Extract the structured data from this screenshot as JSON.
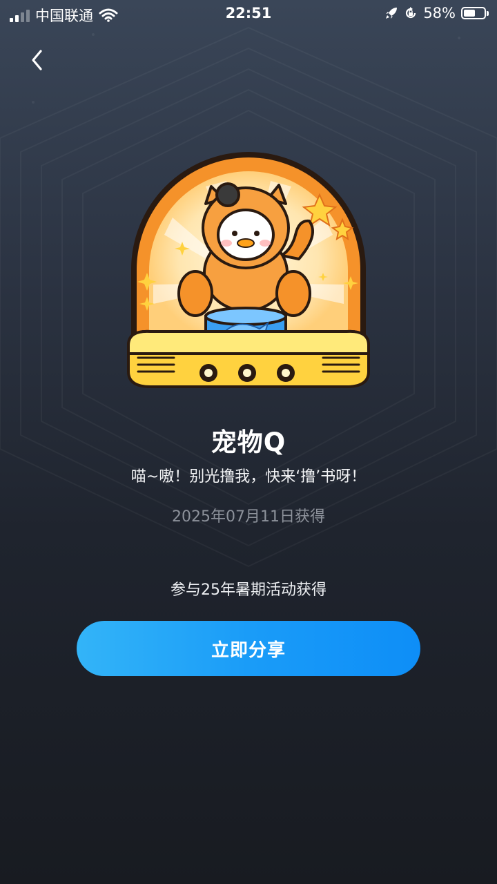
{
  "status_bar": {
    "carrier": "中国联通",
    "time": "22:51",
    "battery_percent": "58%",
    "battery_level": 0.58,
    "icons": [
      "signal-icon",
      "wifi-icon",
      "rocket-icon",
      "rotation-lock-icon",
      "battery-icon"
    ]
  },
  "nav": {
    "back_icon": "chevron-left-icon"
  },
  "badge": {
    "name": "宠物Q",
    "slogan": "喵~嗷！别光撸我，快来‘撸’书呀！",
    "obtained_date": "2025年07月11日获得",
    "description": "参与25年暑期活动获得"
  },
  "actions": {
    "share_label": "立即分享"
  },
  "colors": {
    "share_button_start": "#33b4f8",
    "share_button_end": "#0e8ef7",
    "badge_orange": "#f5922a",
    "badge_yellow": "#ffd23f"
  }
}
